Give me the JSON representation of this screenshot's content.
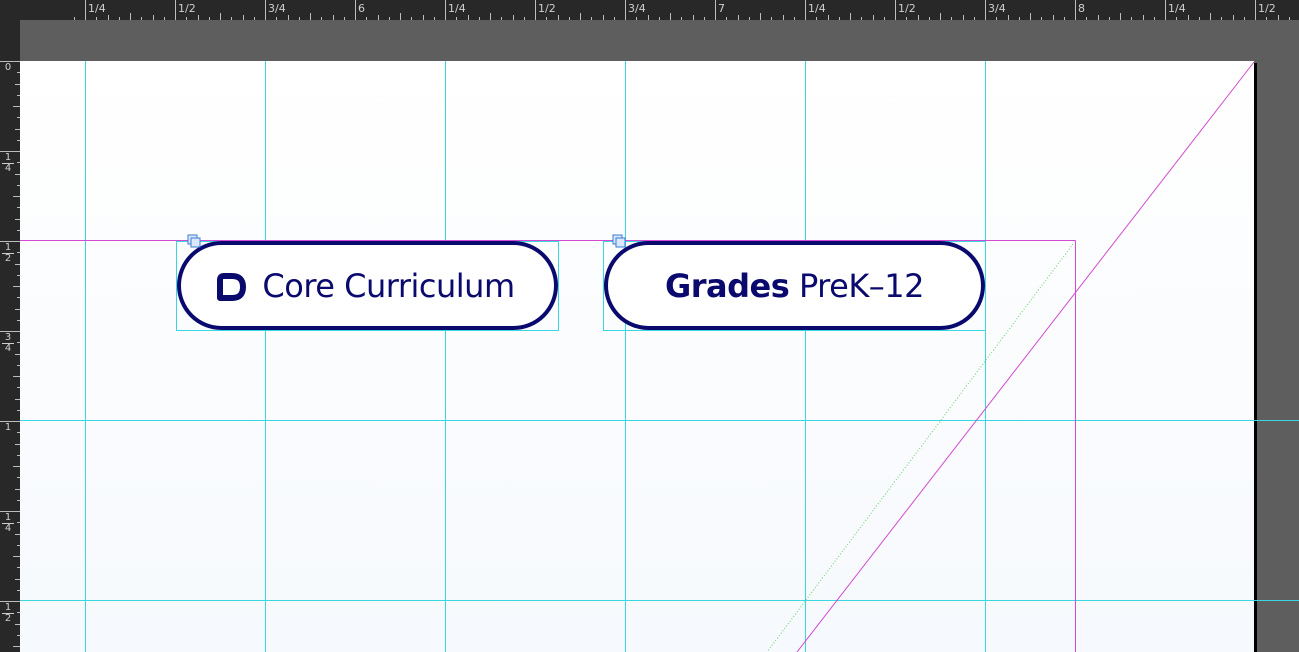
{
  "ruler": {
    "horizontal_labels": [
      "1/4",
      "1/2",
      "3/4",
      "6",
      "1/4",
      "1/2",
      "3/4",
      "7",
      "1/4",
      "1/2",
      "3/4",
      "8",
      "1/4",
      "1/2"
    ],
    "vertical_labels": [
      {
        "num": "0",
        "den": ""
      },
      {
        "num": "1",
        "den": "4"
      },
      {
        "num": "1",
        "den": "2"
      },
      {
        "num": "3",
        "den": "4"
      },
      {
        "num": "1",
        "den": ""
      },
      {
        "num": "1",
        "den": "4"
      },
      {
        "num": "1",
        "den": "2"
      }
    ]
  },
  "frames": {
    "core": {
      "label": "Core Curriculum",
      "icon": "d-logo-icon"
    },
    "grades": {
      "bold": "Grades",
      "rest": " PreK–12"
    }
  },
  "colors": {
    "navy": "#0a0a6e",
    "guide_cyan": "#3ad7e3",
    "margin_magenta": "#d24bd2",
    "bleed_line": "#d24bd2",
    "dotted_green": "#5fd35f",
    "pasteboard": "#5e5e5e",
    "ruler_bg": "#282828"
  }
}
